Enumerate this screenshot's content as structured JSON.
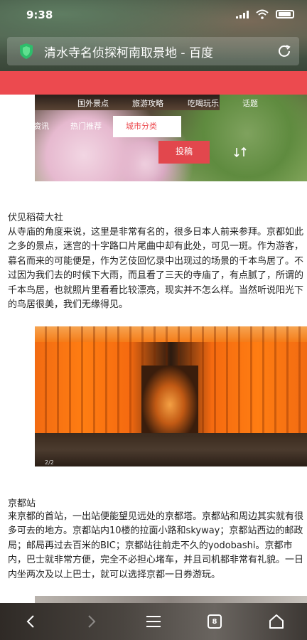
{
  "status_bar": {
    "time": "9:38"
  },
  "browser": {
    "page_title": "清水寺名侦探柯南取景地 - 百度",
    "security_icon": "shield-icon",
    "refresh_icon": "refresh-icon"
  },
  "hero": {
    "nav_row1": [
      "国外景点",
      "旅游攻略",
      "吃喝玩乐",
      "话题"
    ],
    "nav_row2": [
      "资讯",
      "热门推荐"
    ],
    "city_button": "城市分类",
    "submit_button": "投稿"
  },
  "article": {
    "section1_heading": "伏见稻荷大社",
    "section1_body": "从寺庙的角度来说，这里是非常有名的，很多日本人前来参拜。京都如此之多的景点，迷宫的十字路口片尾曲中却有此处，可见一斑。作为游客，慕名而来的可能便是，作为艺伎回忆录中出现过的场景的千本鸟居了。不过因为我们去的时候下大雨，而且看了三天的寺庙了，有点腻了，所谓的千本鸟居，也就照片里看看比较漂亮，现实并不怎么样。当然听说阳光下的鸟居很美，我们无缘得见。",
    "photo_counter": "2/2",
    "section2_heading": "京都站",
    "section2_body": "来京都的首站，一出站便能望见远处的京都塔。京都站和周边其实就有很多可去的地方。京都站内10楼的拉面小路和skyway；京都站西边的邮政局；邮局再过去百米的BIC；京都站往前走不久的yodobashi。京都市内，巴士就非常方便，完全不必担心堵车，并且司机都非常有礼貌。一日内坐两次及以上巴士，就可以选择京都一日券游玩。"
  },
  "bottom_nav": {
    "tab_count": "8",
    "icons": [
      "back-icon",
      "forward-icon",
      "menu-icon",
      "tabs-icon",
      "home-icon"
    ]
  },
  "colors": {
    "accent_red": "#ec4a4f"
  }
}
